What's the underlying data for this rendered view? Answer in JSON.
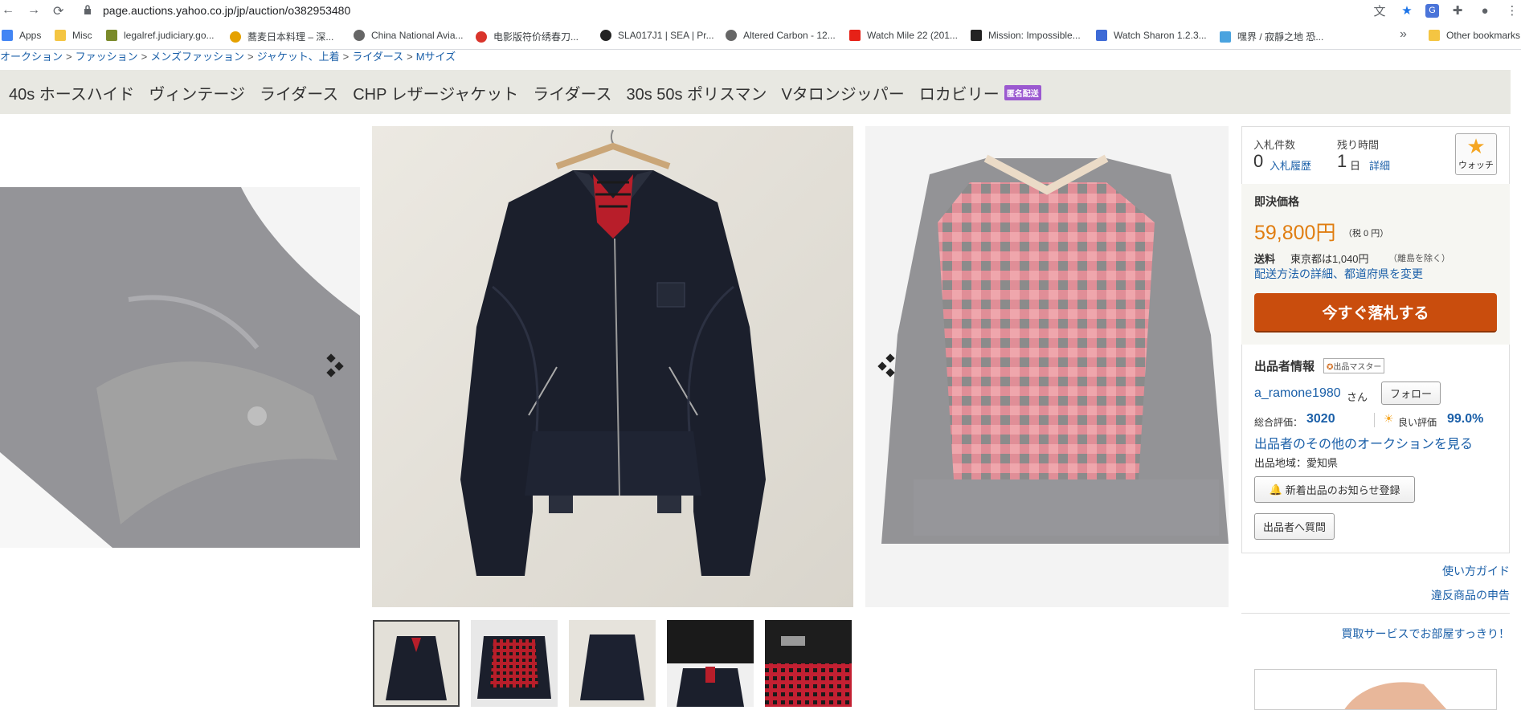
{
  "browser": {
    "url": "page.auctions.yahoo.co.jp/jp/auction/o382953480",
    "bookmarks": [
      {
        "label": "Apps",
        "icon": "apps-grid-icon",
        "color": "#4285f4"
      },
      {
        "label": "Misc",
        "icon": "folder-icon",
        "color": "#f4c542"
      },
      {
        "label": "legalref.judiciary.go...",
        "icon": "legalref-icon",
        "color": "#7a8a2a"
      },
      {
        "label": "蕎麦日本料理 – 深...",
        "icon": "soba-icon",
        "color": "#e5a100"
      },
      {
        "label": "China National Avia...",
        "icon": "globe-icon",
        "color": "#666666"
      },
      {
        "label": "电影版符价绣春刀...",
        "icon": "douban-icon",
        "color": "#d9342b"
      },
      {
        "label": "SLA017J1 | SEA | Pr...",
        "icon": "seiko-icon",
        "color": "#222222"
      },
      {
        "label": "Altered Carbon - 12...",
        "icon": "globe-icon",
        "color": "#666666"
      },
      {
        "label": "Watch Mile 22 (201...",
        "icon": "youtube-icon",
        "color": "#e62117"
      },
      {
        "label": "Mission: Impossible...",
        "icon": "imdb-icon",
        "color": "#222222"
      },
      {
        "label": "Watch Sharon 1.2.3...",
        "icon": "play-icon",
        "color": "#3d6ad6"
      },
      {
        "label": "嘿界 / 寂靜之地 恐...",
        "icon": "site-icon",
        "color": "#4aa3df"
      }
    ],
    "other_bookmarks": "Other bookmarks"
  },
  "breadcrumb": [
    "オークション",
    "ファッション",
    "メンズファッション",
    "ジャケット、上着",
    "ライダース",
    "Mサイズ"
  ],
  "tags": [
    "40s ホースハイド",
    "ヴィンテージ",
    "ライダース",
    "CHP レザージャケット",
    "ライダース",
    "30s 50s ポリスマン",
    "Vタロンジッパー",
    "ロカビリー"
  ],
  "anon_badge": "匿名配送",
  "panel": {
    "bids_label": "入札件数",
    "bids_value": "0",
    "bid_history": "入札履歴",
    "time_label": "残り時間",
    "time_value": "1",
    "time_unit": "日",
    "time_detail": "詳細",
    "watch_label": "ウォッチ",
    "buyout_label": "即決価格",
    "price": "59,800円",
    "tax": "（税 0 円）",
    "shipping_label": "送料",
    "shipping_value": "東京都は1,040円",
    "shipping_note": "（離島を除く）",
    "shipping_link": "配送方法の詳細、都道府県を変更",
    "buy_now": "今すぐ落札する",
    "seller_info": "出品者情報",
    "seller_badge": "出品マスター",
    "seller_name": "a_ramone1980",
    "seller_suffix": "さん",
    "follow": "フォロー",
    "rating_label": "総合評価：",
    "rating_value": "3020",
    "good_label": "良い評価",
    "good_value": "99.0%",
    "other_auctions": "出品者のその他のオークションを見る",
    "region": "出品地域：愛知県",
    "notify": "新着出品のお知らせ登録",
    "question": "出品者へ質問"
  },
  "links": {
    "guide": "使い方ガイド",
    "report": "違反商品の申告",
    "buyback": "買取サービスでお部屋すっきり！"
  },
  "colors": {
    "accent": "#c94d0d",
    "price": "#e07d10",
    "link": "#1a5fa8"
  }
}
